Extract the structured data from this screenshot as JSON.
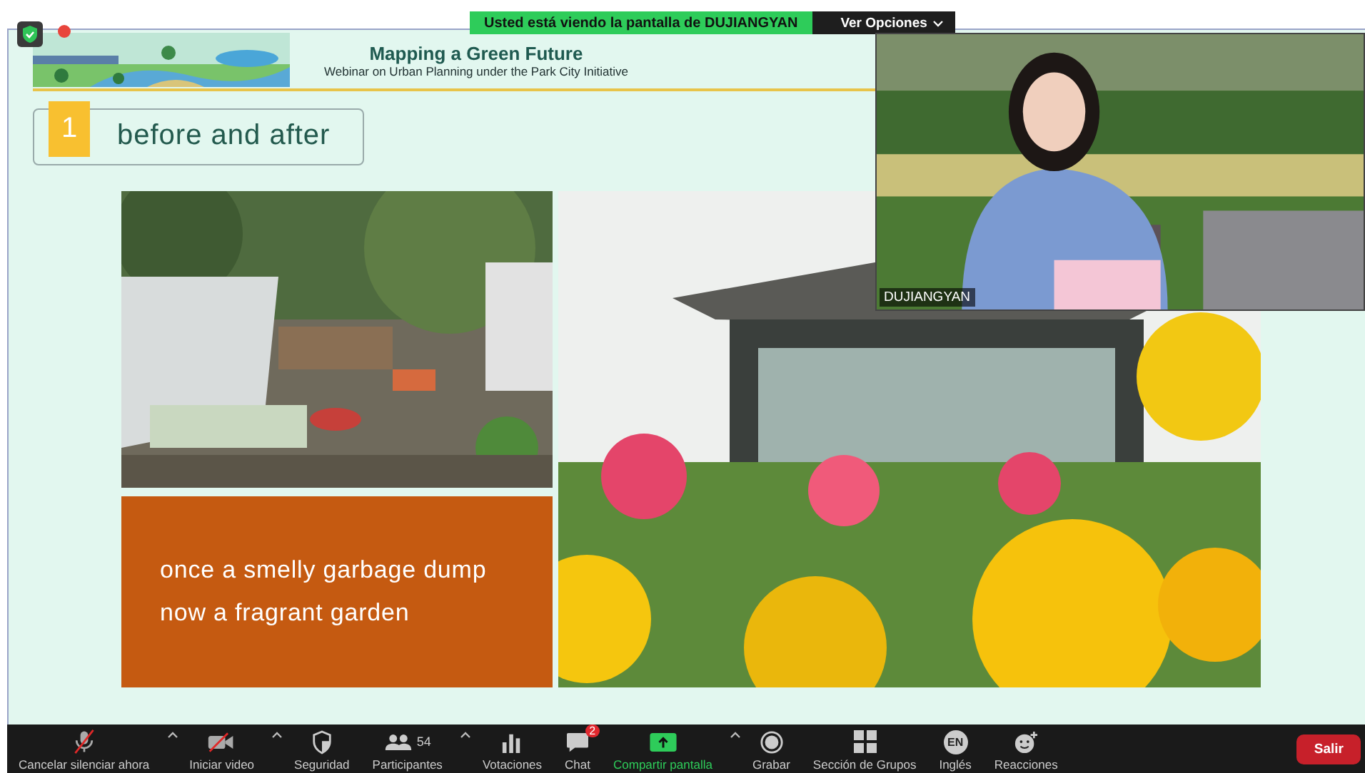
{
  "share_banner": {
    "text": "Usted está viendo la pantalla de DUJIANGYAN",
    "options": "Ver Opciones"
  },
  "slide": {
    "title": "Mapping a Green Future",
    "subtitle": "Webinar on  Urban Planning under the Park City Initiative",
    "section_number": "1",
    "section_title": "before and after",
    "caption_lines": [
      "once a smelly garbage dump",
      "now a  fragrant garden"
    ]
  },
  "video": {
    "name": "DUJIANGYAN"
  },
  "toolbar": [
    {
      "kind": "mute",
      "label": "Cancelar silenciar ahora",
      "caret": true,
      "active": false
    },
    {
      "kind": "video",
      "label": "Iniciar video",
      "caret": true,
      "active": false
    },
    {
      "kind": "security",
      "label": "Seguridad",
      "caret": false,
      "active": false
    },
    {
      "kind": "participants",
      "label": "Participantes",
      "count": "54",
      "caret": true,
      "active": false
    },
    {
      "kind": "polls",
      "label": "Votaciones",
      "caret": false,
      "active": false
    },
    {
      "kind": "chat",
      "label": "Chat",
      "badge": "2",
      "caret": false,
      "active": false
    },
    {
      "kind": "share",
      "label": "Compartir pantalla",
      "caret": true,
      "active": true
    },
    {
      "kind": "record",
      "label": "Grabar",
      "caret": false,
      "active": false
    },
    {
      "kind": "rooms",
      "label": "Sección de Grupos",
      "caret": false,
      "active": false
    },
    {
      "kind": "language",
      "label": "Inglés",
      "icon_text": "EN",
      "caret": false,
      "active": false
    },
    {
      "kind": "reactions",
      "label": "Reacciones",
      "caret": false,
      "active": false
    }
  ],
  "leave_button": "Salir"
}
